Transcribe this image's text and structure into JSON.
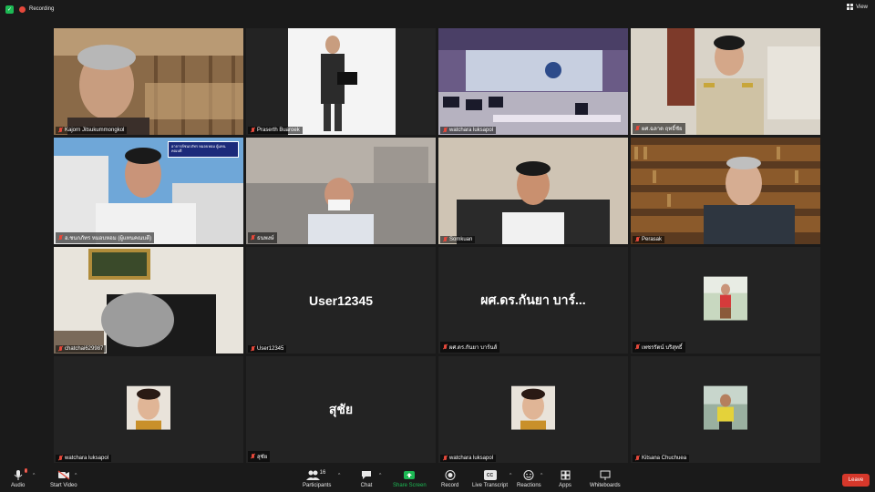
{
  "topbar": {
    "recording_label": "Recording",
    "view_label": "View"
  },
  "tiles": [
    {
      "name": "Kajorn Jitsukummongkol",
      "type": "video"
    },
    {
      "name": "Praserth Buaroek",
      "type": "video"
    },
    {
      "name": "watchara luksapol",
      "type": "video"
    },
    {
      "name": "ผศ.ฉลาด ฤทธิ์ชัย",
      "type": "video"
    },
    {
      "name": "อ.ชนกภัทร หมอบหอม (ผู้แทนคณบดี)",
      "type": "video",
      "slide_text": "อาจารย์ชนกภัทร หมอบหอม ผู้แทนคณบดี"
    },
    {
      "name": "ธนพงษ์",
      "type": "video"
    },
    {
      "name": "Somkuan",
      "type": "video"
    },
    {
      "name": "Perasak",
      "type": "video",
      "speaking": true
    },
    {
      "name": "chatchai629987",
      "type": "video"
    },
    {
      "name": "User12345",
      "type": "name",
      "display": "User12345"
    },
    {
      "name": "ผศ.ดร.กันยา บาร์นส์",
      "type": "name",
      "display": "ผศ.ดร.กันยา บาร์..."
    },
    {
      "name": "เพชรรัตน์ บริสุทธิ์",
      "type": "avatar"
    },
    {
      "name": "watchara luksapol",
      "type": "avatar"
    },
    {
      "name": "สุชัย",
      "type": "name",
      "display": "สุชัย"
    },
    {
      "name": "watchara luksapol",
      "type": "avatar"
    },
    {
      "name": "Kitsana Chuchuea",
      "type": "avatar"
    }
  ],
  "toolbar": {
    "audio": "Audio",
    "audio_badge": "!",
    "video": "Start Video",
    "participants": "Participants",
    "participants_count": "16",
    "chat": "Chat",
    "share": "Share Screen",
    "record": "Record",
    "transcript": "Live Transcript",
    "transcript_icon": "CC",
    "reactions": "Reactions",
    "apps": "Apps",
    "whiteboards": "Whiteboards",
    "leave": "Leave"
  },
  "colors": {
    "background": "#1a1a1a",
    "tile": "#232323",
    "speaking_border": "#e6d34a",
    "share_green": "#1db954",
    "leave_red": "#d6382b",
    "mute_red": "#e5483b"
  }
}
